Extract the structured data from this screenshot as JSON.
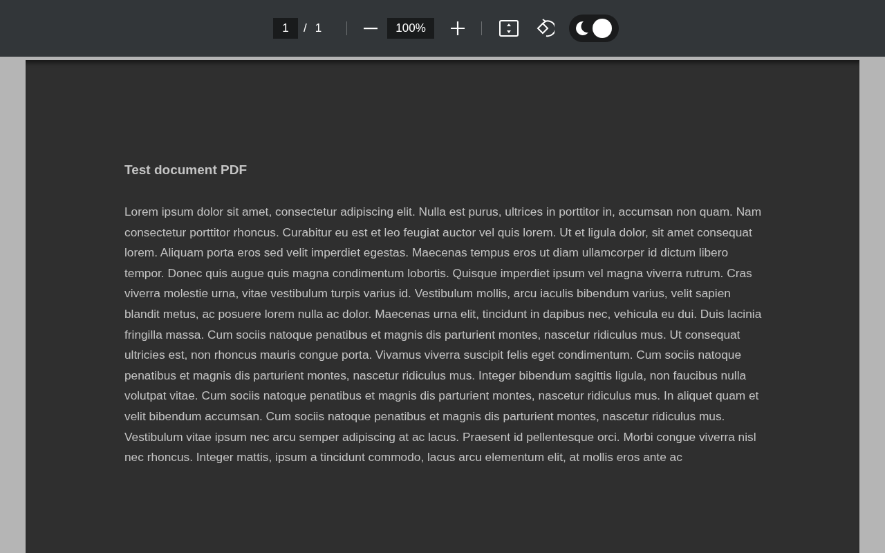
{
  "toolbar": {
    "page_input": {
      "value": "1"
    },
    "page_separator": "/",
    "page_total": "1",
    "zoom": {
      "value": "100%"
    },
    "dark_mode": true
  },
  "document": {
    "title": "Test document PDF",
    "paragraph": "Lorem ipsum dolor sit amet, consectetur adipiscing elit. Nulla est purus, ultrices in porttitor in, accumsan non quam. Nam consectetur porttitor rhoncus. Curabitur eu est et leo feugiat auctor vel quis lorem. Ut et ligula dolor, sit amet consequat lorem. Aliquam porta eros sed velit imperdiet egestas. Maecenas tempus eros ut diam ullamcorper id dictum libero tempor. Donec quis augue quis magna condimentum lobortis. Quisque imperdiet ipsum vel magna viverra rutrum. Cras viverra molestie urna, vitae vestibulum turpis varius id. Vestibulum mollis, arcu iaculis bibendum varius, velit sapien blandit metus, ac posuere lorem nulla ac dolor. Maecenas urna elit, tincidunt in dapibus nec, vehicula eu dui. Duis lacinia fringilla massa. Cum sociis natoque penatibus et magnis dis parturient montes, nascetur ridiculus mus. Ut consequat ultricies est, non rhoncus mauris congue porta. Vivamus viverra suscipit felis eget condimentum. Cum sociis natoque penatibus et magnis dis parturient montes, nascetur ridiculus mus. Integer bibendum sagittis ligula, non faucibus nulla volutpat vitae. Cum sociis natoque penatibus et magnis dis parturient montes, nascetur ridiculus mus. In aliquet quam et velit bibendum accumsan. Cum sociis natoque penatibus et magnis dis parturient montes, nascetur ridiculus mus. Vestibulum vitae ipsum nec arcu semper adipiscing at ac lacus. Praesent id pellentesque orci. Morbi congue viverra nisl nec rhoncus. Integer mattis, ipsum a tincidunt commodo, lacus arcu elementum elit, at mollis eros ante ac"
  }
}
